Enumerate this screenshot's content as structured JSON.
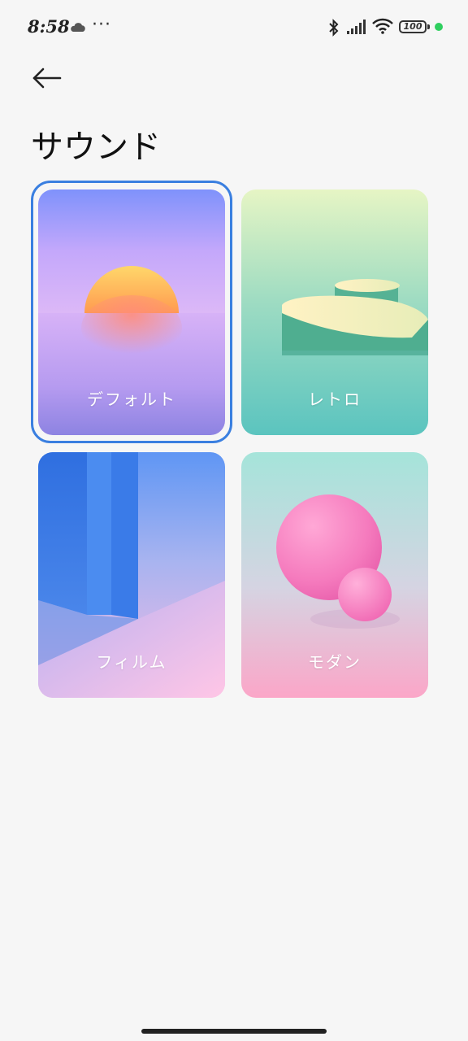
{
  "status_bar": {
    "time": "8:58",
    "battery": "100",
    "icons": [
      "cloud-icon",
      "more-icon",
      "bluetooth-icon",
      "signal-icon",
      "wifi-icon",
      "battery-icon"
    ],
    "more": "···"
  },
  "header": {
    "back_icon": "arrow-left-icon",
    "title": "サウンド"
  },
  "themes": [
    {
      "label": "デフォルト",
      "selected": true
    },
    {
      "label": "レトロ",
      "selected": false
    },
    {
      "label": "フィルム",
      "selected": false
    },
    {
      "label": "モダン",
      "selected": false
    }
  ],
  "colors": {
    "selection_border": "#3a7fe0",
    "status_dot": "#2fcf5f"
  }
}
